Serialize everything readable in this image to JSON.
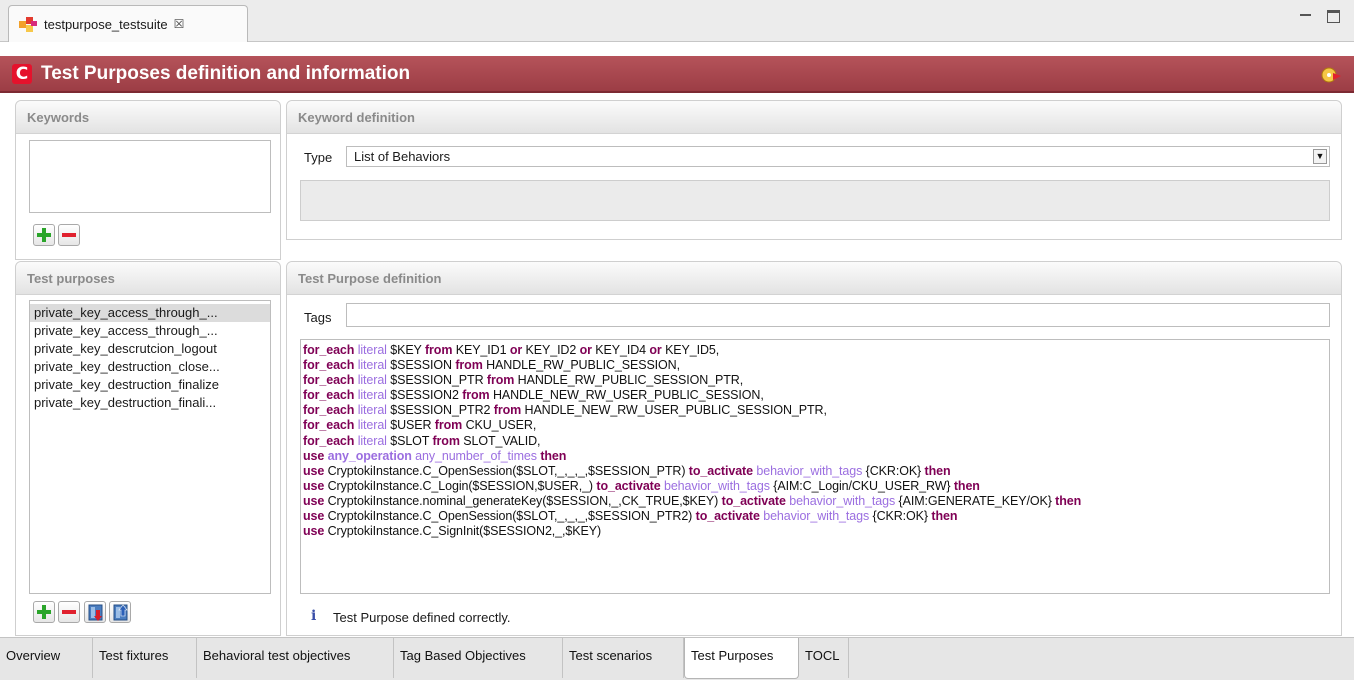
{
  "editor_tab": {
    "title": "testpurpose_testsuite",
    "close_glyph": "☒"
  },
  "header": {
    "title": "Test Purposes definition and information",
    "logo_letter": "C"
  },
  "keywords": {
    "title": "Keywords"
  },
  "keyword_definition": {
    "title": "Keyword definition",
    "type_label": "Type",
    "type_value": "List of Behaviors",
    "dropdown_glyph": "▼"
  },
  "test_purposes": {
    "title": "Test purposes",
    "items": [
      "private_key_access_through_...",
      "private_key_access_through_...",
      "private_key_descrutcion_logout",
      "private_key_destruction_close...",
      "private_key_destruction_finalize",
      "private_key_destruction_finali..."
    ]
  },
  "test_purpose_definition": {
    "title": "Test Purpose definition",
    "tags_label": "Tags",
    "tags_value": "",
    "code": {
      "l1": {
        "a": "for_each",
        "b": "literal",
        "c": "$KEY",
        "d": "from",
        "e": "KEY_ID1",
        "f": "or",
        "g": "KEY_ID2",
        "h": "or",
        "i": "KEY_ID4",
        "j": "or",
        "k": "KEY_ID5,"
      },
      "l2": {
        "a": "for_each",
        "b": "literal",
        "c": "$SESSION",
        "d": "from",
        "e": "HANDLE_RW_PUBLIC_SESSION,"
      },
      "l3": {
        "a": "for_each",
        "b": "literal",
        "c": "$SESSION_PTR",
        "d": "from",
        "e": "HANDLE_RW_PUBLIC_SESSION_PTR,"
      },
      "l4": {
        "a": "for_each",
        "b": "literal",
        "c": "$SESSION2",
        "d": "from",
        "e": "HANDLE_NEW_RW_USER_PUBLIC_SESSION,"
      },
      "l5": {
        "a": "for_each",
        "b": "literal",
        "c": "$SESSION_PTR2",
        "d": "from",
        "e": "HANDLE_NEW_RW_USER_PUBLIC_SESSION_PTR,"
      },
      "l6": {
        "a": "for_each",
        "b": "literal",
        "c": "$USER",
        "d": "from",
        "e": "CKU_USER,"
      },
      "l7": {
        "a": "for_each",
        "b": "literal",
        "c": "$SLOT",
        "d": "from",
        "e": "SLOT_VALID,"
      },
      "l8": {
        "a": "use",
        "b": "any_operation",
        "c": "any_number_of_times",
        "d": "then"
      },
      "l9": {
        "a": "use",
        "b": "CryptokiInstance.C_OpenSession($SLOT,_,_,_,$SESSION_PTR)",
        "c": "to_activate",
        "d": "behavior_with_tags",
        "e": "{CKR:OK}",
        "f": "then"
      },
      "l10": {
        "a": "use",
        "b": "CryptokiInstance.C_Login($SESSION,$USER,_)",
        "c": "to_activate",
        "d": "behavior_with_tags",
        "e": "{AIM:C_Login/CKU_USER_RW}",
        "f": "then"
      },
      "l11": {
        "a": "use",
        "b": "CryptokiInstance.nominal_generateKey($SESSION,_,CK_TRUE,$KEY)",
        "c": "to_activate",
        "d": "behavior_with_tags",
        "e": "{AIM:GENERATE_KEY/OK}",
        "f": "then"
      },
      "l12": {
        "a": "use",
        "b": "CryptokiInstance.C_OpenSession($SLOT,_,_,_,$SESSION_PTR2)",
        "c": "to_activate",
        "d": "behavior_with_tags",
        "e": "{CKR:OK}",
        "f": "then"
      },
      "l13": {
        "a": "use",
        "b": "CryptokiInstance.C_SignInit($SESSION2,_,$KEY)"
      }
    },
    "status_icon": "i",
    "status_text": "Test Purpose defined correctly."
  },
  "page_tabs": [
    "Overview",
    "Test fixtures",
    "Behavioral test objectives",
    "Tag Based Objectives",
    "Test scenarios",
    "Test Purposes",
    "TOCL"
  ],
  "active_page_tab": "Test Purposes",
  "icons": {
    "editor_tab_icon": "test-suite-icon",
    "header_logo": "cryptoki-logo-icon",
    "header_help": "help-icon",
    "add": "plus-icon",
    "remove": "minus-icon",
    "import": "import-icon",
    "export": "export-icon",
    "status": "info-icon"
  },
  "colors": {
    "header_bg": "#a8464e",
    "keyword": "#7f0055",
    "literal": "#9b6ee0",
    "plus": "#2aa52a",
    "minus": "#e0212e",
    "section_title": "#8a8a8a"
  }
}
